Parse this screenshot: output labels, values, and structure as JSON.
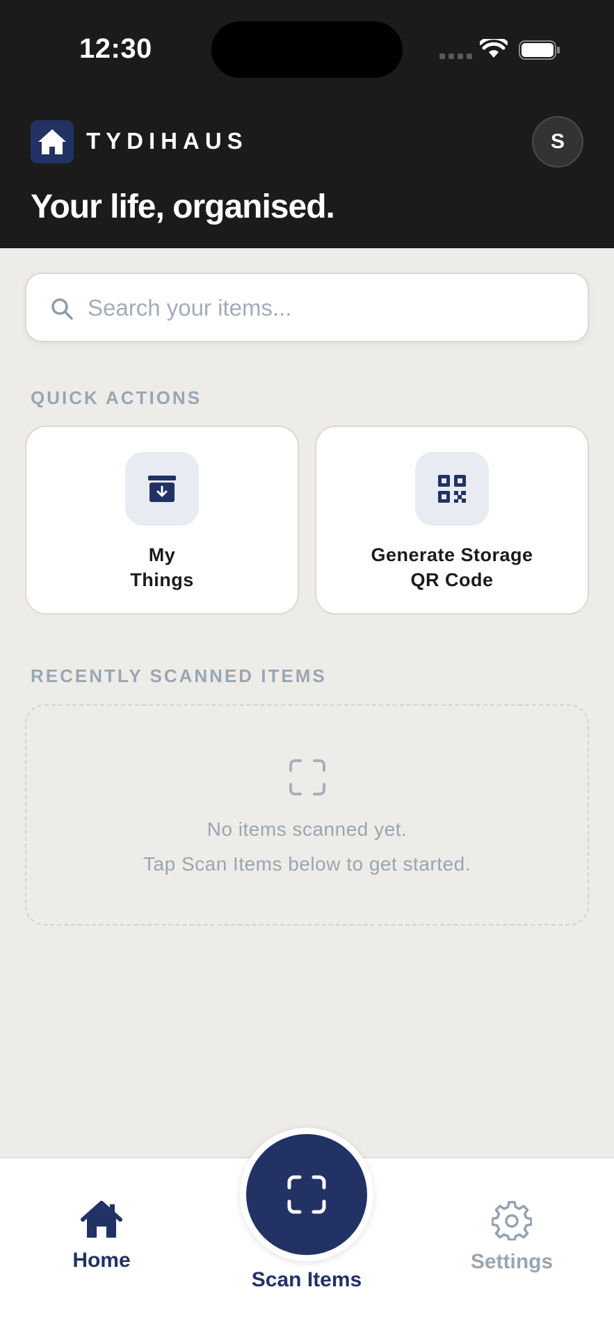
{
  "status_bar": {
    "time": "12:30"
  },
  "header": {
    "brand": "TYDIHAUS",
    "avatar_initial": "S",
    "tagline": "Your life, organised."
  },
  "search": {
    "placeholder": "Search your items...",
    "value": ""
  },
  "quick_actions": {
    "label": "QUICK ACTIONS",
    "items": [
      {
        "label": "My\nThings",
        "icon": "archive-box-icon"
      },
      {
        "label": "Generate Storage\nQR Code",
        "icon": "qr-code-icon"
      }
    ]
  },
  "recent": {
    "label": "RECENTLY SCANNED ITEMS",
    "empty_line1": "No items scanned yet.",
    "empty_line2": "Tap Scan Items below to get started.",
    "icon": "scan-frame-icon"
  },
  "bottom_nav": {
    "home": "Home",
    "scan": "Scan Items",
    "settings": "Settings"
  },
  "colors": {
    "header_bg": "#1b1b1b",
    "accent_navy": "#223265",
    "page_bg": "#eeece8",
    "muted_label": "#98a6b4"
  }
}
